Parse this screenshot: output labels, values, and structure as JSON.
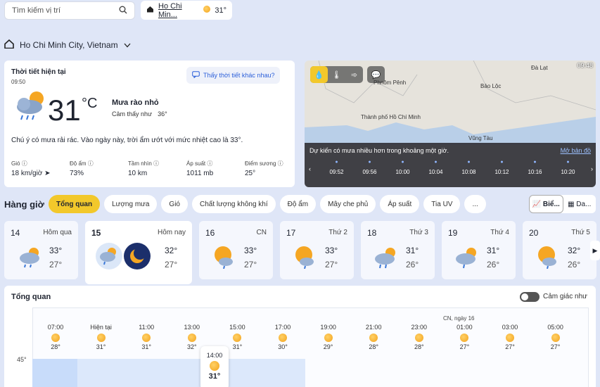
{
  "search": {
    "placeholder": "Tìm kiếm vị trí"
  },
  "location_chip": {
    "name": "Ho Chi Min...",
    "temp": "31°"
  },
  "city": {
    "name": "Ho Chi Minh City, Vietnam"
  },
  "current": {
    "title": "Thời tiết hiện tại",
    "time": "09:50",
    "other_link": "Thấy thời tiết khác nhau?",
    "temp": "31",
    "unit": "°C",
    "condition": "Mưa rào nhỏ",
    "feels_label": "Cảm thấy như",
    "feels_value": "36°",
    "description": "Chú ý có mưa rải rác. Vào ngày này, trời ẩm ướt với mức nhiệt cao là 33°.",
    "stats": [
      {
        "label": "Gió",
        "value": "18 km/giờ"
      },
      {
        "label": "Độ ẩm",
        "value": "73%"
      },
      {
        "label": "Tầm nhìn",
        "value": "10 km"
      },
      {
        "label": "Áp suất",
        "value": "1011 mb"
      },
      {
        "label": "Điểm sương",
        "value": "25°"
      }
    ]
  },
  "map": {
    "time": "09:48",
    "labels": [
      "Đà Lạt",
      "Phnôm Pênh",
      "Bảo Lộc",
      "Thành phố Hồ Chí Minh",
      "Vũng Tàu"
    ],
    "forecast": "Dự kiến có mưa nhiều hơn trong khoảng một giờ.",
    "link": "Mở bản đồ",
    "timeline": [
      "09:52",
      "09:56",
      "10:00",
      "10:04",
      "10:08",
      "10:12",
      "10:16",
      "10:20"
    ]
  },
  "hourly_label": "Hàng giờ",
  "tabs": [
    "Tổng quan",
    "Lượng mưa",
    "Gió",
    "Chất lượng không khí",
    "Độ ẩm",
    "Mây che phủ",
    "Áp suất",
    "Tia UV",
    "..."
  ],
  "view_switch": [
    "Biể...",
    "Da..."
  ],
  "days": [
    {
      "num": "14",
      "label": "Hôm qua",
      "hi": "33°",
      "lo": "27°"
    },
    {
      "num": "15",
      "label": "Hôm nay",
      "hi": "32°",
      "lo": "27°"
    },
    {
      "num": "16",
      "label": "CN",
      "hi": "33°",
      "lo": "27°"
    },
    {
      "num": "17",
      "label": "Thứ 2",
      "hi": "33°",
      "lo": "27°"
    },
    {
      "num": "18",
      "label": "Thứ 3",
      "hi": "31°",
      "lo": "26°"
    },
    {
      "num": "19",
      "label": "Thứ 4",
      "hi": "31°",
      "lo": "26°"
    },
    {
      "num": "20",
      "label": "Thứ 5",
      "hi": "32°",
      "lo": "26°"
    }
  ],
  "overview": {
    "title": "Tổng quan",
    "toggle_label": "Cảm giác như",
    "day_header": "CN, ngày 16",
    "y_label": "45°",
    "hours": [
      {
        "h": "07:00",
        "t": "28°"
      },
      {
        "h": "Hiện tại",
        "t": "31°"
      },
      {
        "h": "11:00",
        "t": "31°"
      },
      {
        "h": "13:00",
        "t": "32°"
      },
      {
        "h": "15:00",
        "t": "31°"
      },
      {
        "h": "17:00",
        "t": "30°"
      },
      {
        "h": "19:00",
        "t": "29°"
      },
      {
        "h": "21:00",
        "t": "28°"
      },
      {
        "h": "23:00",
        "t": "28°"
      },
      {
        "h": "01:00",
        "t": "27°"
      },
      {
        "h": "03:00",
        "t": "27°"
      },
      {
        "h": "05:00",
        "t": "27°"
      }
    ],
    "tooltip": {
      "time": "14:00",
      "temp": "31°"
    }
  }
}
